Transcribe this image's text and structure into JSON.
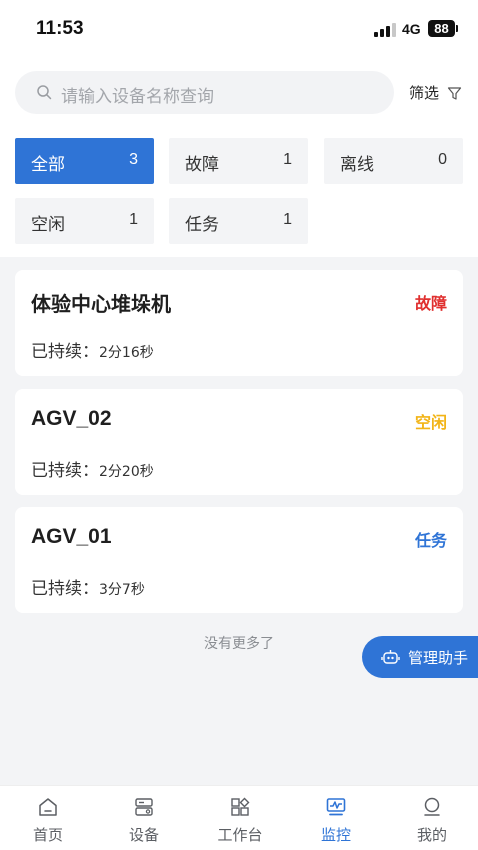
{
  "status_bar": {
    "time": "11:53",
    "network": "4G",
    "battery": "88"
  },
  "search": {
    "placeholder": "请输入设备名称查询"
  },
  "filter": {
    "label": "筛选"
  },
  "chips": [
    {
      "label": "全部",
      "count": "3",
      "active": true
    },
    {
      "label": "故障",
      "count": "1",
      "active": false
    },
    {
      "label": "离线",
      "count": "0",
      "active": false
    },
    {
      "label": "空闲",
      "count": "1",
      "active": false
    },
    {
      "label": "任务",
      "count": "1",
      "active": false
    }
  ],
  "devices": [
    {
      "name": "体验中心堆垛机",
      "status": "故障",
      "status_color": "#e0302f",
      "duration_label": "已持续：",
      "duration": "2分16秒"
    },
    {
      "name": "AGV_02",
      "status": "空闲",
      "status_color": "#f2b417",
      "duration_label": "已持续：",
      "duration": "2分20秒"
    },
    {
      "name": "AGV_01",
      "status": "任务",
      "status_color": "#2f74d6",
      "duration_label": "已持续：",
      "duration": "3分7秒"
    }
  ],
  "list_footer": "没有更多了",
  "assistant": {
    "label": "管理助手"
  },
  "nav": [
    {
      "label": "首页",
      "icon": "home-icon",
      "active": false
    },
    {
      "label": "设备",
      "icon": "device-icon",
      "active": false
    },
    {
      "label": "工作台",
      "icon": "workbench-icon",
      "active": false
    },
    {
      "label": "监控",
      "icon": "monitor-icon",
      "active": true
    },
    {
      "label": "我的",
      "icon": "profile-icon",
      "active": false
    }
  ],
  "colors": {
    "accent": "#2f74d6",
    "fault": "#e0302f",
    "idle": "#f2b417",
    "task": "#2f74d6"
  }
}
